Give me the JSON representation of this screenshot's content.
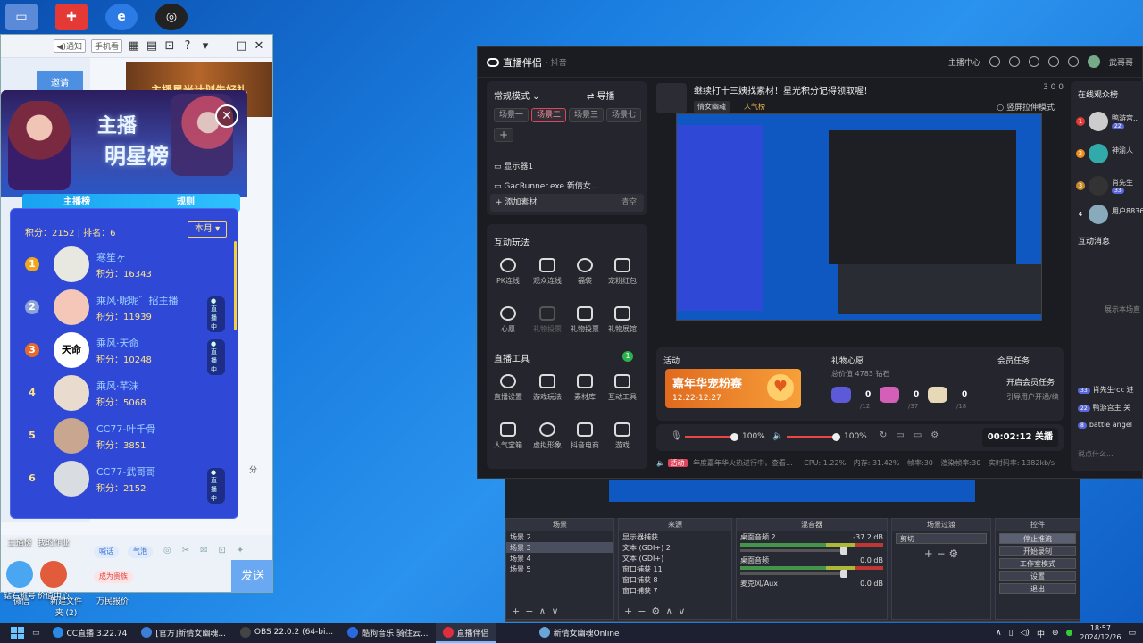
{
  "desktop": {
    "icons_bottom": [
      "微信",
      "新建文件夹 (2)",
      "万民报价"
    ],
    "icons_bottom2": [
      "主播榜",
      "我的作业",
      "钻石称号",
      "价值中心"
    ]
  },
  "cc_window": {
    "title_buttons": {
      "notify": "◀)通知",
      "phone": "手机看"
    },
    "invite": "邀请",
    "banner": "主播星光计划先好礼",
    "star_panel": {
      "title_line1": "主播",
      "title_line2": "明星榜",
      "tabs": [
        "主播榜",
        "规则"
      ],
      "score_line": "积分：2152 | 排名：6",
      "month": "本月",
      "ranks": [
        {
          "rank": "1",
          "name": "寒笙ヶ",
          "score": "积分：16343",
          "live": ""
        },
        {
          "rank": "2",
          "name": "乘风·昵昵゛招主播",
          "score": "积分：11939",
          "live": "● 直播中"
        },
        {
          "rank": "3",
          "name": "乘风·天命",
          "score": "积分：10248",
          "live": "● 直播中"
        },
        {
          "rank": "4",
          "name": "乘风·芊沫",
          "score": "积分：5068",
          "live": ""
        },
        {
          "rank": "5",
          "name": "CC77-叶千骨",
          "score": "积分：3851",
          "live": ""
        },
        {
          "rank": "6",
          "name": "CC77-武哥哥",
          "score": "积分：2152",
          "live": "● 直播中"
        }
      ],
      "avatar_text": "天命"
    },
    "bottom": {
      "chip1": "喊话",
      "chip2": "气泡",
      "chip3": "成为贵族",
      "send": "发送",
      "side_text": "分"
    }
  },
  "douyin": {
    "title": "直播伴侣",
    "subtitle": "· 抖音",
    "top_right": [
      "主播中心",
      "武哥哥"
    ],
    "scenes": {
      "mode": "常规模式",
      "guide": "导播",
      "tags": [
        "场景一",
        "场景二",
        "场景三",
        "场景七"
      ],
      "sources": [
        "显示器1",
        "GacRunner.exe 新倩女..."
      ],
      "add": "添加素材",
      "clear": "清空"
    },
    "play": {
      "title": "互动玩法",
      "tools": [
        "PK连线",
        "观众连线",
        "福袋",
        "宠粉红包",
        "心愿",
        "礼物投票",
        "礼物投票",
        "礼物展馆"
      ],
      "tools_title": "直播工具",
      "tools_badge": "1",
      "tools2": [
        "直播设置",
        "游戏玩法",
        "素材库",
        "互动工具",
        "人气宝箱",
        "虚拟形象",
        "抖音电商",
        "游戏"
      ]
    },
    "head": {
      "title": "继续打十三姨找素材！星光积分记得领取喔！",
      "tags": [
        "倩女幽魂",
        "人气榜"
      ],
      "stats": "3   0   0",
      "vertical": "竖屏拉伸模式"
    },
    "bottom": {
      "activity_t": "活动",
      "activity_card": "嘉年华宠粉赛",
      "activity_date": "12.22-12.27",
      "wish_t": "礼物心愿",
      "wish_total": "总价值 4783 钻石",
      "gifts": [
        {
          "count": "0",
          "den": "/12"
        },
        {
          "count": "0",
          "den": "/37"
        },
        {
          "count": "0",
          "den": "/18"
        }
      ],
      "member_t": "会员任务",
      "member_1": "开启会员任务",
      "member_2": "引导用户开通/续"
    },
    "ctrl": {
      "mic": "100%",
      "spk": "100%",
      "timer": "00:02:12 关播"
    },
    "status": {
      "hot": "活动",
      "text": "年度嘉年华火热进行中，查看...",
      "cpu": "CPU: 1.22%",
      "mem": "内存: 31.42%",
      "fps": "帧率:30",
      "render": "渲染帧率:30",
      "rate": "实时码率: 1382kb/s"
    },
    "right": {
      "viewers_t": "在线观众榜",
      "viewers": [
        {
          "rank": "1",
          "name": "鸭游宫...",
          "lv": "22"
        },
        {
          "rank": "2",
          "name": "神渝人",
          "lv": ""
        },
        {
          "rank": "3",
          "name": "肖先生",
          "lv": "33"
        },
        {
          "rank": "4",
          "name": "用户8836",
          "lv": ""
        }
      ],
      "msgs_t": "互动消息",
      "msgs_hint": "展示本场直",
      "msgs": [
        {
          "lv": "33",
          "text": "肖先生·cc 进"
        },
        {
          "lv": "22",
          "text": "鸭游宫主 关"
        },
        {
          "lv": "8",
          "text": "battle angel"
        }
      ],
      "input_ph": "说点什么..."
    }
  },
  "obs": {
    "docks": {
      "scene_t": "场景",
      "scenes": [
        "场景 2",
        "场景 3",
        "场景 4",
        "场景 5"
      ],
      "source_t": "来源",
      "sources": [
        "显示器捕获",
        "文本 (GDI+) 2",
        "文本 (GDI+)",
        "窗口捕获 11",
        "窗口捕获 8",
        "窗口捕获 7"
      ],
      "mixer_t": "混音器",
      "mixer": [
        {
          "name": "桌面音频 2",
          "db": "-37.2 dB"
        },
        {
          "name": "桌面音频",
          "db": "0.0 dB"
        },
        {
          "name": "麦克风/Aux",
          "db": "0.0 dB"
        }
      ],
      "trans_t": "场景过渡",
      "trans": "剪切",
      "ctrl_t": "控件",
      "ctrl": [
        "停止推流",
        "开始录制",
        "工作室模式",
        "设置",
        "退出"
      ]
    }
  },
  "taskbar": {
    "tasks": [
      "CC直播 3.22.74",
      "[官方]新倩女幽魂...",
      "OBS 22.0.2 (64-bi...",
      "酷狗音乐 骑往云...",
      "直播伴侣",
      "新倩女幽魂Online"
    ],
    "tray_lang": "中",
    "time": "18:57",
    "date": "2024/12/26"
  }
}
